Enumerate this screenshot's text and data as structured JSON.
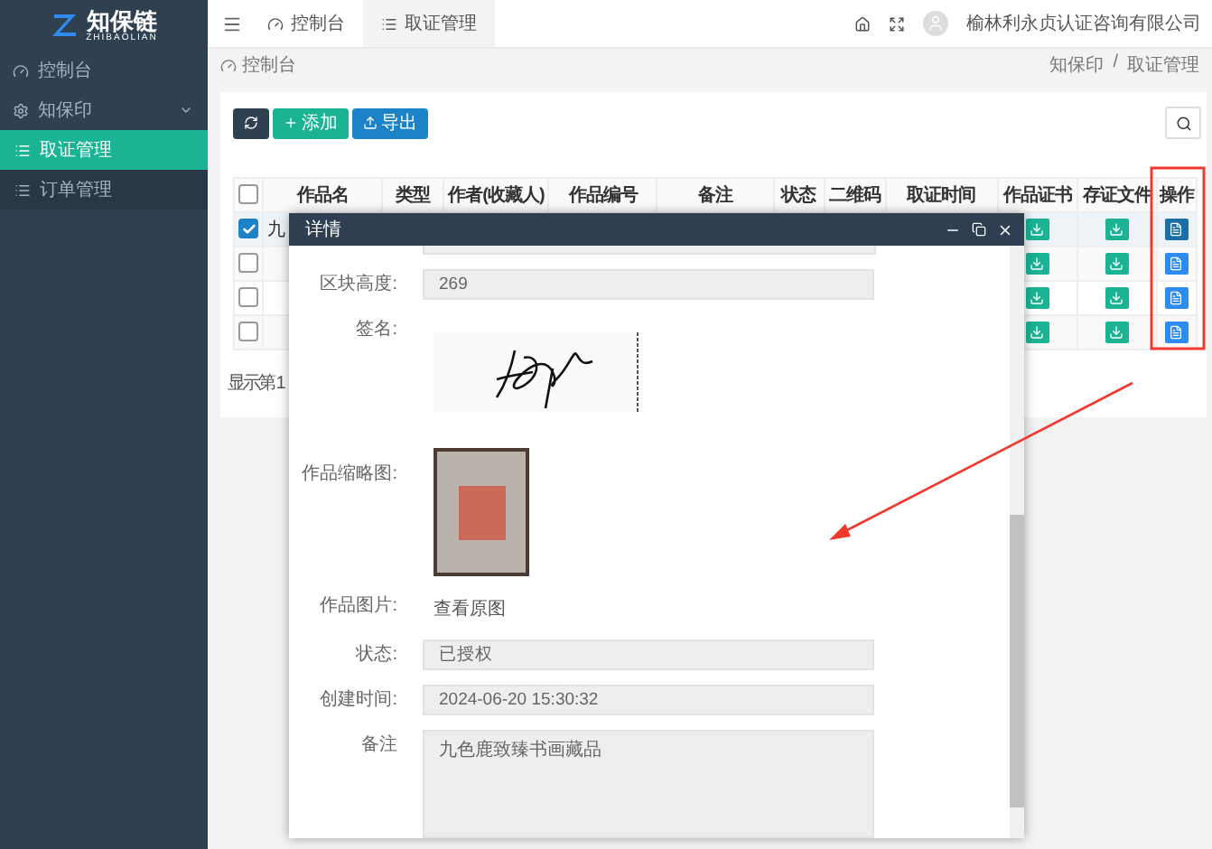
{
  "logo": {
    "name": "知保链",
    "subtitle": "ZHIBAOLIAN"
  },
  "sidebar": {
    "items": [
      {
        "label": "控制台",
        "kind": "dashboard",
        "selected": false
      },
      {
        "label": "知保印",
        "kind": "gear",
        "selected": false,
        "expanded": true,
        "children": [
          {
            "label": "取证管理",
            "selected": true
          },
          {
            "label": "订单管理",
            "selected": false
          }
        ]
      }
    ]
  },
  "topbar": {
    "tabs": [
      {
        "label": "控制台",
        "kind": "dashboard",
        "selected": false
      },
      {
        "label": "取证管理",
        "kind": "list",
        "selected": true
      }
    ],
    "user": "榆林利永贞认证咨询有限公司"
  },
  "breadcrumb": {
    "current": "控制台",
    "trail": [
      "知保印",
      "取证管理"
    ],
    "separator": "/"
  },
  "toolbar": {
    "buttons": [
      {
        "kind": "refresh"
      },
      {
        "kind": "add",
        "label": "添加"
      },
      {
        "kind": "export",
        "label": "导出"
      }
    ]
  },
  "table": {
    "all_checked": false,
    "columns": [
      "作品名",
      "类型",
      "作者(收藏人)",
      "作品编号",
      "备注",
      "状态",
      "二维码",
      "取证时间",
      "作品证书",
      "存证文件",
      "操作"
    ],
    "rows": [
      {
        "selected": true,
        "name": "九"
      },
      {
        "selected": false
      },
      {
        "selected": false
      },
      {
        "selected": false
      }
    ]
  },
  "pagination": "显示第 1",
  "dialog": {
    "title": "详情",
    "fields": [
      {
        "kind": "input",
        "label": "区块高度:",
        "value": "269"
      },
      {
        "kind": "signature",
        "label": "签名:"
      },
      {
        "kind": "image",
        "label": "作品缩略图:"
      },
      {
        "kind": "link",
        "label": "作品图片:",
        "value": "查看原图"
      },
      {
        "kind": "input",
        "label": "状态:",
        "value": "已授权"
      },
      {
        "kind": "input",
        "label": "创建时间:",
        "value": "2024-06-20 15:30:32"
      },
      {
        "kind": "textarea",
        "label": "备注",
        "value": "九色鹿致臻书画藏品"
      }
    ]
  }
}
